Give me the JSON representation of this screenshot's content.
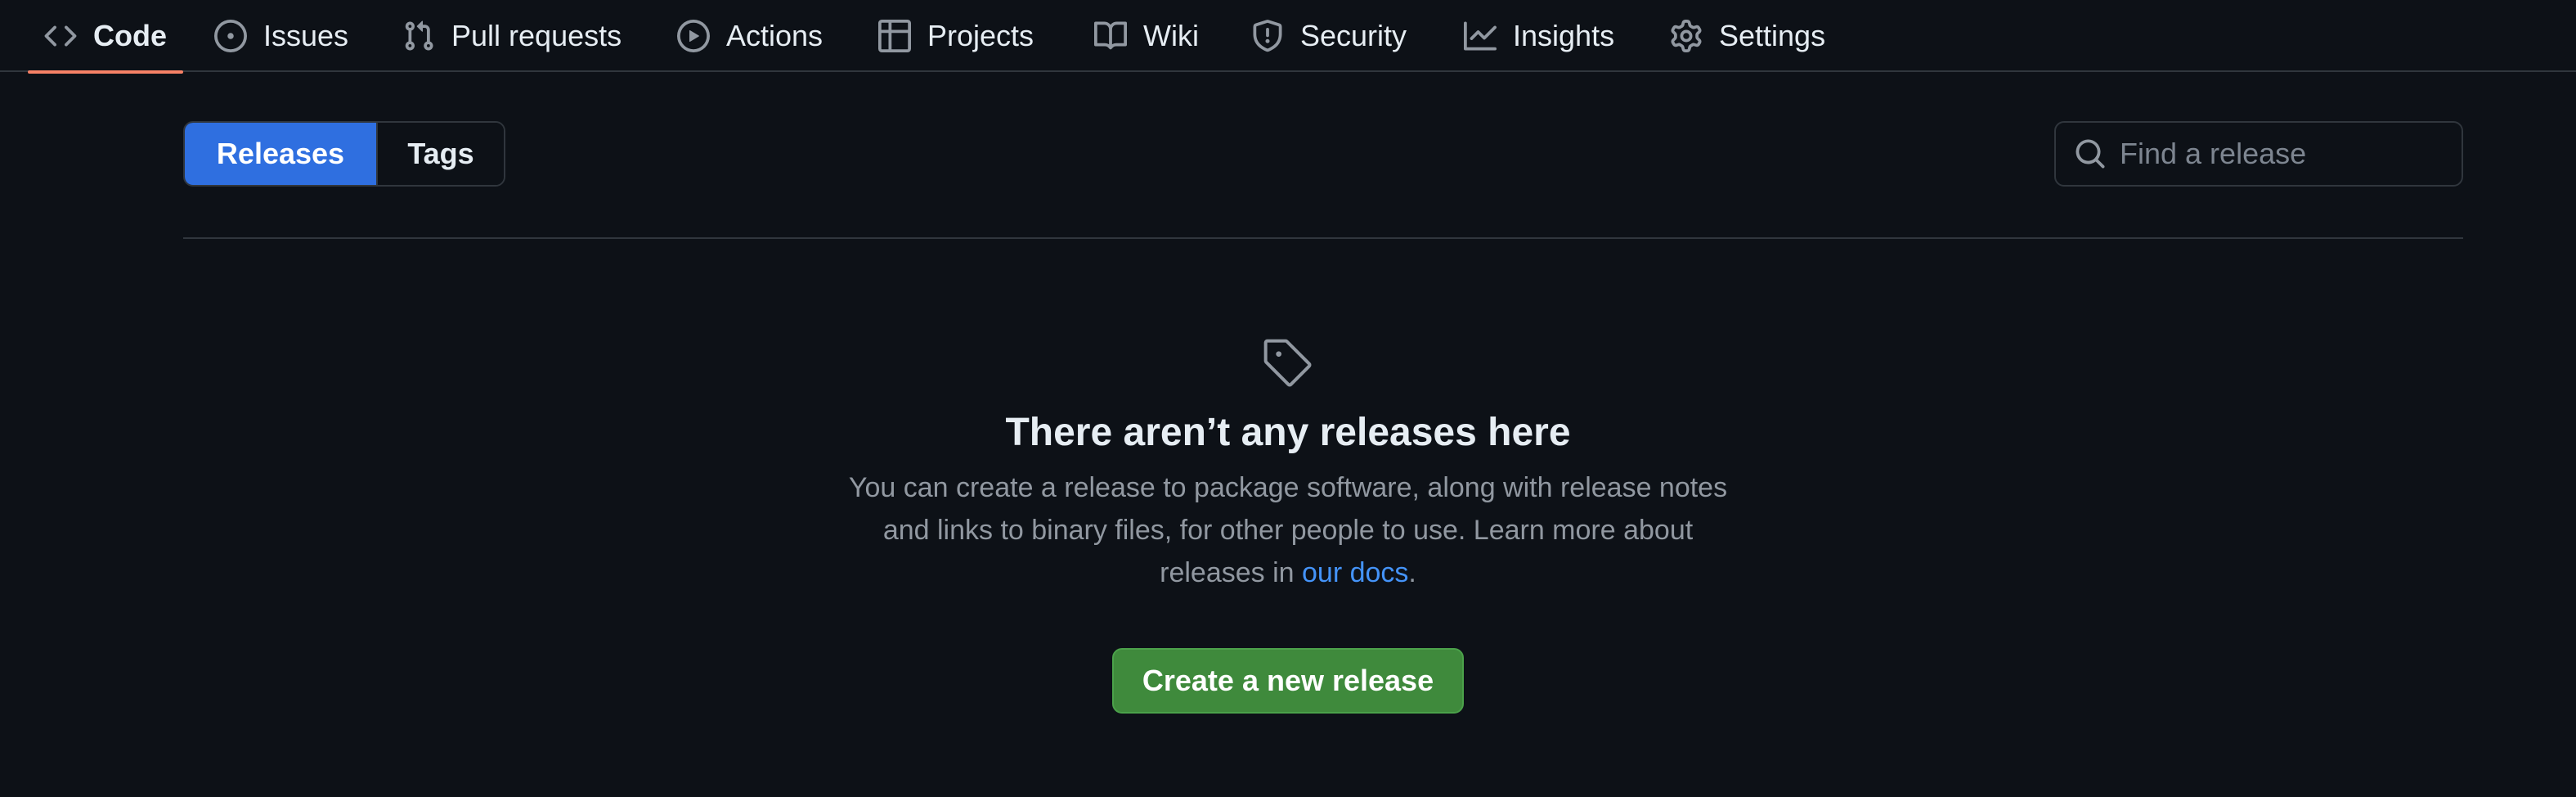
{
  "nav": {
    "tabs": [
      {
        "label": "Code",
        "icon": "code-icon",
        "selected": true
      },
      {
        "label": "Issues",
        "icon": "issue-opened-icon"
      },
      {
        "label": "Pull requests",
        "icon": "git-pull-request-icon"
      },
      {
        "label": "Actions",
        "icon": "play-icon"
      },
      {
        "label": "Projects",
        "icon": "table-icon"
      },
      {
        "label": "Wiki",
        "icon": "book-icon"
      },
      {
        "label": "Security",
        "icon": "shield-icon"
      },
      {
        "label": "Insights",
        "icon": "graph-icon"
      },
      {
        "label": "Settings",
        "icon": "gear-icon"
      }
    ]
  },
  "toggle": {
    "releases": "Releases",
    "tags": "Tags",
    "selected": "Releases"
  },
  "search": {
    "placeholder": "Find a release",
    "value": ""
  },
  "blank_state": {
    "icon": "tag-icon",
    "title": "There aren’t any releases here",
    "description_before_link": "You can create a release to package software, along with release notes and links to binary files, for other people to use. Learn more about releases in ",
    "link_text": "our docs",
    "description_after_link": ".",
    "button_label": "Create a new release"
  },
  "colors": {
    "background": "#0d1117",
    "border": "#30363d",
    "selected_tab_underline": "#f78166",
    "accent_blue": "#2f6fe0",
    "link": "#4493f8",
    "primary_button": "#3f8a3c"
  }
}
